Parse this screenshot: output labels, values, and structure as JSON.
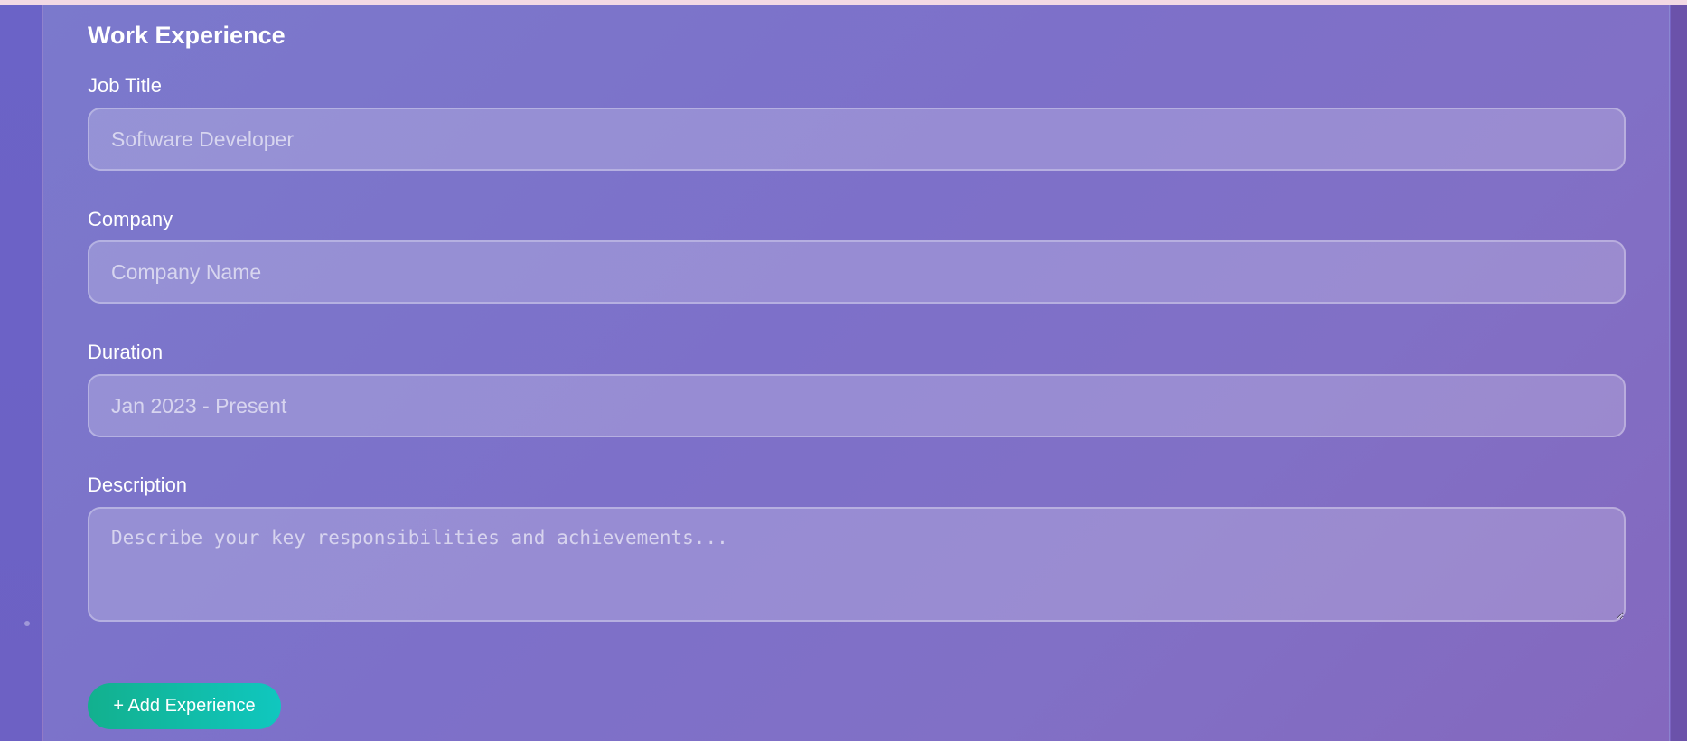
{
  "section": {
    "title": "Work Experience"
  },
  "fields": {
    "job_title": {
      "label": "Job Title",
      "placeholder": "Software Developer",
      "value": ""
    },
    "company": {
      "label": "Company",
      "placeholder": "Company Name",
      "value": ""
    },
    "duration": {
      "label": "Duration",
      "placeholder": "Jan 2023 - Present",
      "value": ""
    },
    "description": {
      "label": "Description",
      "placeholder": "Describe your key responsibilities and achievements...",
      "value": ""
    }
  },
  "actions": {
    "add_experience_label": "+ Add Experience"
  },
  "colors": {
    "button_gradient_start": "#12b08e",
    "button_gradient_end": "#10c7bf",
    "background": "#7d70c9"
  }
}
